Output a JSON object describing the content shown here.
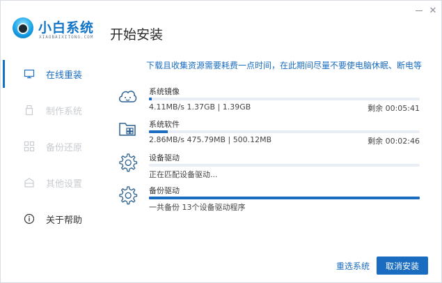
{
  "window": {
    "minimize_icon": "minimize-icon",
    "close_icon": "close-icon"
  },
  "logo": {
    "name": "小白系统",
    "subtitle": "XIAOBAIXITONG.COM"
  },
  "page_title": "开始安装",
  "sidebar": {
    "items": [
      {
        "label": "在线重装",
        "icon": "monitor-icon",
        "state": "active"
      },
      {
        "label": "制作系统",
        "icon": "usb-drive-icon",
        "state": "disabled"
      },
      {
        "label": "备份还原",
        "icon": "restore-icon",
        "state": "disabled"
      },
      {
        "label": "其他设置",
        "icon": "box-icon",
        "state": "disabled"
      },
      {
        "label": "关于帮助",
        "icon": "info-icon",
        "state": "normal"
      }
    ]
  },
  "notice": "下载且收集资源需要耗费一点时间，在此期间尽量不要使电脑休眠、断电等",
  "tasks": [
    {
      "name": "系统镜像",
      "icon": "cloud-icon",
      "progress": 0.01,
      "detail": "4.11MB/s 1.37GB | 1.39GB",
      "remaining": "剩余 00:05:41"
    },
    {
      "name": "系统软件",
      "icon": "folder-icon",
      "progress": 0.07,
      "detail": "2.86MB/s 475.79MB | 500.12MB",
      "remaining": "剩余 00:02:46"
    },
    {
      "name": "设备驱动",
      "icon": "gear-icon",
      "progress": 0.0,
      "detail": "正在匹配设备驱动...",
      "remaining": ""
    },
    {
      "name": "备份驱动",
      "icon": "gear-icon",
      "progress": 1.0,
      "detail": "一共备份 13个设备驱动程序",
      "remaining": ""
    }
  ],
  "buttons": {
    "reselect": "重选系统",
    "cancel": "取消安装"
  },
  "colors": {
    "accent": "#1a6cc0",
    "disabled": "#c8ccd1",
    "track": "#e9eef5"
  }
}
